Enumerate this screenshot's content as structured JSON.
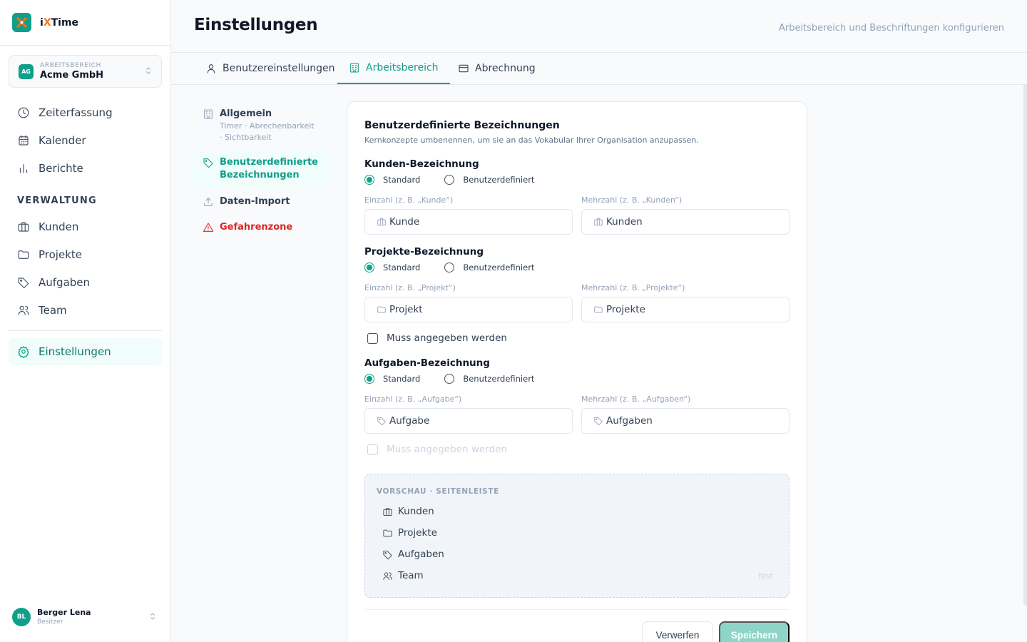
{
  "brand": {
    "name_prefix": "i",
    "name_x": "X",
    "name_suffix": "Time"
  },
  "workspace": {
    "badge": "AG",
    "label": "ARBEITSBEREICH",
    "name": "Acme GmbH"
  },
  "nav": {
    "main": [
      {
        "label": "Zeiterfassung",
        "icon": "clock-icon"
      },
      {
        "label": "Kalender",
        "icon": "calendar-icon"
      },
      {
        "label": "Berichte",
        "icon": "bar-chart-icon"
      }
    ],
    "section_label": "VERWALTUNG",
    "admin": [
      {
        "label": "Kunden",
        "icon": "briefcase-icon"
      },
      {
        "label": "Projekte",
        "icon": "folder-icon"
      },
      {
        "label": "Aufgaben",
        "icon": "tag-icon"
      },
      {
        "label": "Team",
        "icon": "users-icon"
      }
    ],
    "settings": {
      "label": "Einstellungen",
      "icon": "gear-icon"
    }
  },
  "user": {
    "initials": "BL",
    "name": "Berger Lena",
    "role": "Besitzer"
  },
  "header": {
    "title": "Einstellungen",
    "subtitle": "Arbeitsbereich und Beschriftungen konfigurieren"
  },
  "tabs": [
    {
      "label": "Benutzereinstellungen",
      "icon": "user-icon"
    },
    {
      "label": "Arbeitsbereich",
      "icon": "building-icon",
      "active": true
    },
    {
      "label": "Abrechnung",
      "icon": "credit-card-icon"
    }
  ],
  "subnav": [
    {
      "title": "Allgemein",
      "desc_line1": "Timer · Abrechenbarkeit",
      "desc_line2": "· Sichtbarkeit",
      "icon": "building-icon"
    },
    {
      "title_line1": "Benutzerdefinierte",
      "title_line2": "Bezeichnungen",
      "icon": "tag-icon",
      "active": true
    },
    {
      "title": "Daten-Import",
      "icon": "upload-icon"
    },
    {
      "title": "Gefahrenzone",
      "icon": "warning-icon",
      "danger": true
    }
  ],
  "card": {
    "title": "Benutzerdefinierte Bezeichnungen",
    "description": "Kernkonzepte umbenennen, um sie an das Vokabular Ihrer Organisation anzupassen.",
    "radio_standard": "Standard",
    "radio_custom": "Benutzerdefiniert",
    "groups": [
      {
        "title": "Kunden-Bezeichnung",
        "selected": "Standard",
        "singular_label": "Einzahl (z. B. „Kunde“)",
        "singular_value": "Kunde",
        "plural_label": "Mehrzahl (z. B. „Kunden“)",
        "plural_value": "Kunden",
        "icon": "briefcase-icon"
      },
      {
        "title": "Projekte-Bezeichnung",
        "selected": "Standard",
        "singular_label": "Einzahl (z. B. „Projekt“)",
        "singular_value": "Projekt",
        "plural_label": "Mehrzahl (z. B. „Projekte“)",
        "plural_value": "Projekte",
        "icon": "folder-icon",
        "required_label": "Muss angegeben werden",
        "required_checked": false
      },
      {
        "title": "Aufgaben-Bezeichnung",
        "selected": "Standard",
        "singular_label": "Einzahl (z. B. „Aufgabe“)",
        "singular_value": "Aufgabe",
        "plural_label": "Mehrzahl (z. B. „Aufgaben“)",
        "plural_value": "Aufgaben",
        "icon": "tag-icon",
        "required_label": "Muss angegeben werden",
        "required_checked": false,
        "required_disabled": true
      }
    ],
    "preview": {
      "title": "VORSCHAU · SEITENLEISTE",
      "items": [
        {
          "label": "Kunden",
          "icon": "briefcase-icon"
        },
        {
          "label": "Projekte",
          "icon": "folder-icon"
        },
        {
          "label": "Aufgaben",
          "icon": "tag-icon"
        },
        {
          "label": "Team",
          "icon": "users-icon",
          "note": "fest"
        }
      ]
    },
    "buttons": {
      "discard": "Verwerfen",
      "save": "Speichern"
    }
  },
  "colors": {
    "accent": "#0f9f8a",
    "danger": "#dc2626",
    "logo_accent": "#f97316",
    "save_disabled": "#8fd4c8"
  }
}
